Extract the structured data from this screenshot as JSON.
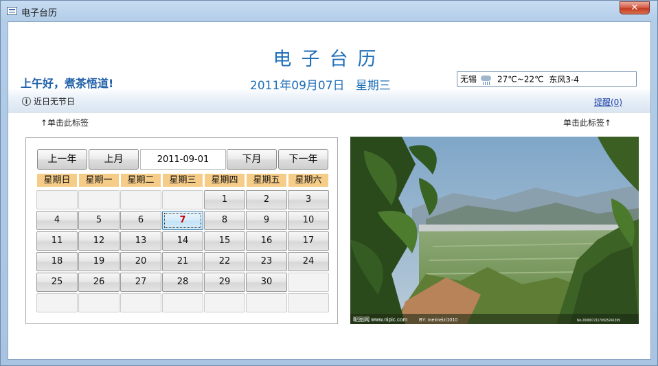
{
  "window": {
    "title": "电子台历",
    "close_glyph": "✕"
  },
  "header": {
    "app_title": "电子台历",
    "greeting": "上午好，煮茶悟道!",
    "date_text": "2011年09月07日   星期三",
    "weather": {
      "city": "无锡",
      "icon": "rain-cloud-icon",
      "temp": "27℃~22℃",
      "wind": "东风3-4"
    },
    "holiday_info": "近日无节日",
    "reminder_link": "提醒(0)"
  },
  "hints": {
    "left": "↑单击此标签",
    "right": "单击此标签↑"
  },
  "calendar": {
    "prev_year": "上一年",
    "prev_month": "上月",
    "current_month": "2011-09-01",
    "next_month": "下月",
    "next_year": "下一年",
    "weekdays": [
      "星期日",
      "星期一",
      "星期二",
      "星期三",
      "星期四",
      "星期五",
      "星期六"
    ],
    "weeks": [
      [
        "",
        "",
        "",
        "",
        "1",
        "2",
        "3"
      ],
      [
        "4",
        "5",
        "6",
        "7",
        "8",
        "9",
        "10"
      ],
      [
        "11",
        "12",
        "13",
        "14",
        "15",
        "16",
        "17"
      ],
      [
        "18",
        "19",
        "20",
        "21",
        "22",
        "23",
        "24"
      ],
      [
        "25",
        "26",
        "27",
        "28",
        "29",
        "30",
        ""
      ],
      [
        "",
        "",
        "",
        "",
        "",
        "",
        ""
      ]
    ],
    "today": "7",
    "today_color": "#cc0000",
    "weekday_header_color": "#f5cc88"
  },
  "photo": {
    "watermark_left": "昵图网 www.nipic.com",
    "watermark_by": "BY: meimeizi1010",
    "watermark_no": "No.20080721170925241399"
  },
  "colors": {
    "accent": "#1f6fb8",
    "link": "#1a3fa6"
  }
}
